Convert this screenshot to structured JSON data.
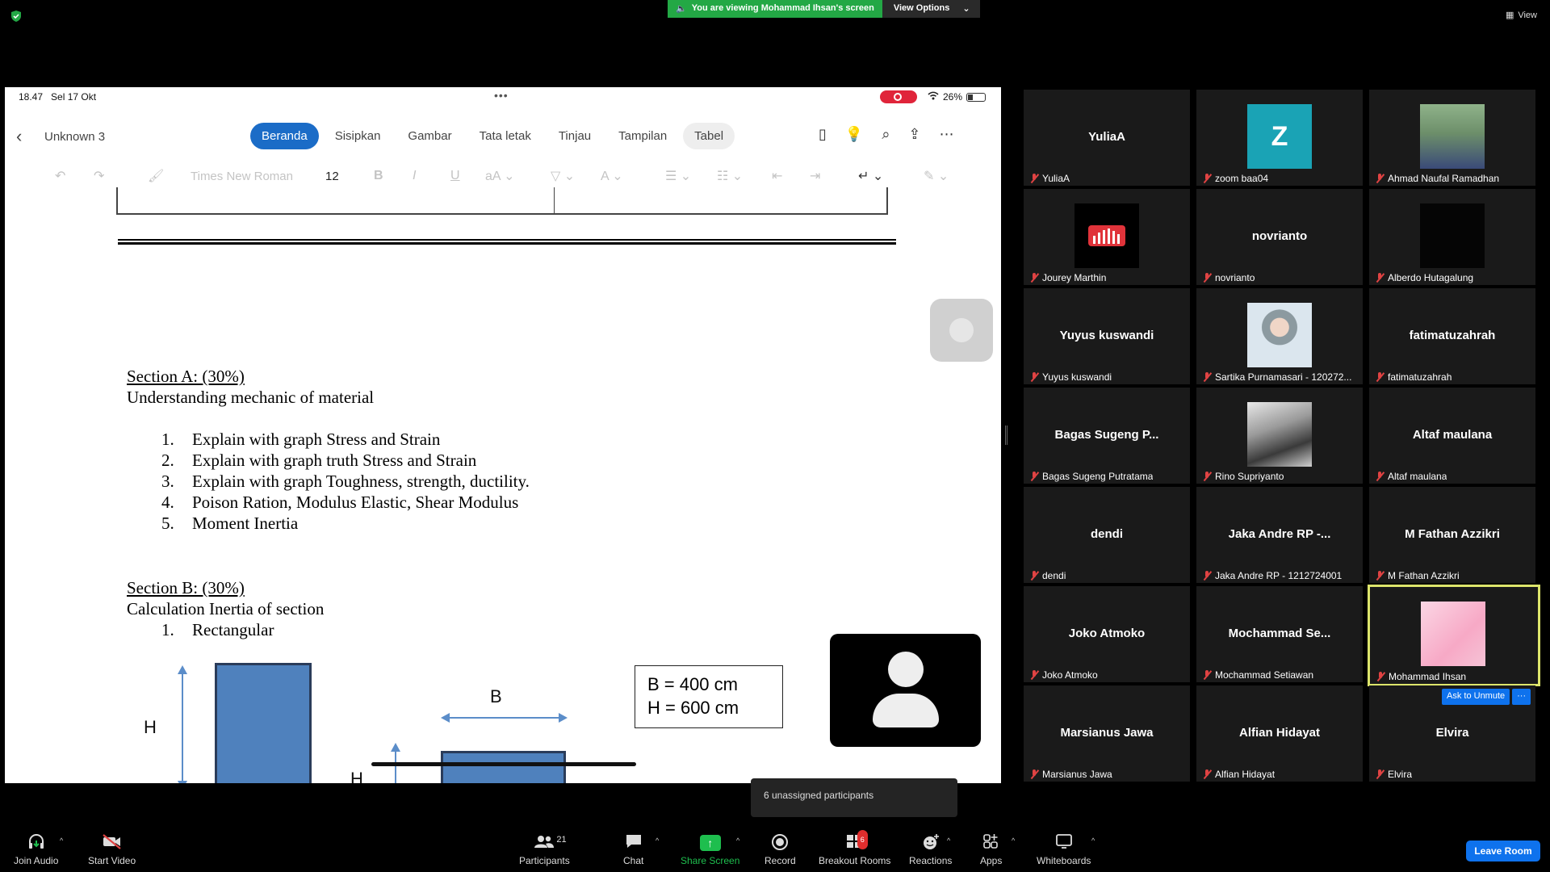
{
  "banner": {
    "sharing_text": "You are viewing Mohammad Ihsan's screen",
    "view_options": "View Options",
    "view": "View"
  },
  "shared_screen": {
    "status": {
      "time": "18.47",
      "date": "Sel 17 Okt",
      "dots": "•••",
      "battery": "26%"
    },
    "doc_name": "Unknown 3",
    "tabs": [
      "Beranda",
      "Sisipkan",
      "Gambar",
      "Tata letak",
      "Tinjau",
      "Tampilan",
      "Tabel"
    ],
    "font_name": "Times New Roman",
    "font_size": "12",
    "section_a": {
      "heading": "Section A: (30%)",
      "subtitle": "Understanding mechanic of material",
      "items": [
        {
          "num": "1.",
          "text": "Explain with graph Stress and Strain"
        },
        {
          "num": "2.",
          "text": "Explain with graph truth Stress and Strain"
        },
        {
          "num": "3.",
          "text": "Explain with graph Toughness, strength, ductility."
        },
        {
          "num": "4.",
          "text": "Poison Ration, Modulus Elastic, Shear Modulus"
        },
        {
          "num": "5.",
          "text": "Moment Inertia"
        }
      ]
    },
    "section_b": {
      "heading": "Section B: (30%)",
      "subtitle": "Calculation Inertia of section",
      "items": [
        {
          "num": "1.",
          "text": "Rectangular"
        }
      ]
    },
    "diagram": {
      "label_h1": "H",
      "label_b1": "B",
      "label_b2": "B",
      "label_h2": "H",
      "value_b": "B = 400 cm",
      "value_h": "H = 600 cm"
    }
  },
  "participants": [
    {
      "big": "YuliaA",
      "name": "YuliaA"
    },
    {
      "big": "Z",
      "name": "zoom baa04",
      "type": "letter"
    },
    {
      "big": "",
      "name": "Ahmad Naufal Ramadhan",
      "type": "photo"
    },
    {
      "big": "",
      "name": "Jourey Marthin",
      "type": "logo"
    },
    {
      "big": "novrianto",
      "name": "novrianto"
    },
    {
      "big": "",
      "name": "Alberdo Hutagalung",
      "type": "dark"
    },
    {
      "big": "Yuyus kuswandi",
      "name": "Yuyus kuswandi"
    },
    {
      "big": "",
      "name": "Sartika Purnamasari - 120272...",
      "type": "photo2"
    },
    {
      "big": "fatimatuzahrah",
      "name": "fatimatuzahrah"
    },
    {
      "big": "Bagas Sugeng P...",
      "name": "Bagas Sugeng Putratama"
    },
    {
      "big": "",
      "name": "Rino Supriyanto",
      "type": "bw"
    },
    {
      "big": "Altaf maulana",
      "name": "Altaf maulana"
    },
    {
      "big": "dendi",
      "name": "dendi"
    },
    {
      "big": "Jaka Andre RP -...",
      "name": "Jaka Andre RP - 1212724001"
    },
    {
      "big": "M Fathan Azzikri",
      "name": "M Fathan Azzikri"
    },
    {
      "big": "Joko Atmoko",
      "name": "Joko Atmoko"
    },
    {
      "big": "Mochammad Se...",
      "name": "Mochammad Setiawan"
    },
    {
      "big": "",
      "name": "Mohammad Ihsan",
      "type": "pink"
    },
    {
      "big": "Marsianus Jawa",
      "name": "Marsianus Jawa"
    },
    {
      "big": "Alfian Hidayat",
      "name": "Alfian Hidayat"
    },
    {
      "big": "Elvira",
      "name": "Elvira"
    }
  ],
  "ask_unmute": "Ask to Unmute",
  "more": "···",
  "unassigned_tooltip": "6 unassigned participants",
  "toolbar": {
    "join_audio": "Join Audio",
    "start_video": "Start Video",
    "participants": "Participants",
    "participants_count": "21",
    "chat": "Chat",
    "share_screen": "Share Screen",
    "record": "Record",
    "breakout_rooms": "Breakout Rooms",
    "breakout_badge": "6",
    "reactions": "Reactions",
    "apps": "Apps",
    "whiteboards": "Whiteboards",
    "leave_room": "Leave Room"
  },
  "colors": {
    "share_green": "#23a845",
    "accent_blue": "#0e72ed",
    "tab_active": "#1b6cc7",
    "rect_fill": "#4f81bd",
    "active_speaker": "#dde56b"
  }
}
